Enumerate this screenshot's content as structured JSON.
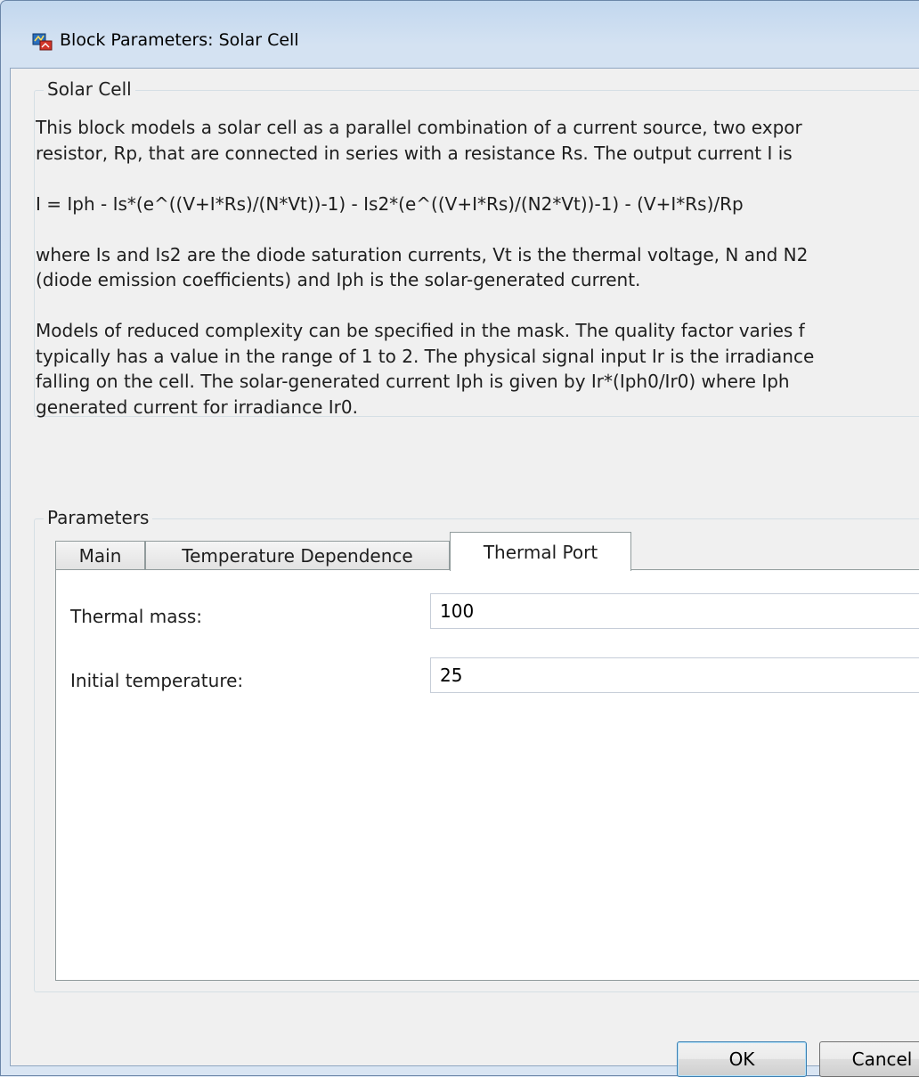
{
  "window": {
    "title": "Block Parameters: Solar Cell",
    "icon": "simulink-block-icon"
  },
  "description_group": {
    "legend": "Solar Cell",
    "lines": [
      "This block models a solar cell as a parallel combination of a current source, two expor",
      "resistor, Rp, that are connected in series with a resistance Rs. The output current I is",
      "",
      "I = Iph - Is*(e^((V+I*Rs)/(N*Vt))-1) - Is2*(e^((V+I*Rs)/(N2*Vt))-1) - (V+I*Rs)/Rp",
      "",
      "where Is and Is2 are the diode saturation currents, Vt is the thermal voltage, N and N2",
      "(diode emission coefficients) and Iph is the solar-generated current.",
      "",
      "Models of reduced complexity can be specified in the mask. The quality factor varies f",
      "typically has a value in the range of 1 to 2. The physical signal input Ir is the irradiance",
      "falling on the cell. The solar-generated current Iph is given by Ir*(Iph0/Ir0) where Iph",
      "generated current for irradiance Ir0."
    ]
  },
  "parameters_group": {
    "legend": "Parameters",
    "tabs": [
      {
        "label": "Main",
        "active": false
      },
      {
        "label": "Temperature Dependence",
        "active": false
      },
      {
        "label": "Thermal Port",
        "active": true
      }
    ],
    "fields": [
      {
        "label": "Thermal mass:",
        "value": "100"
      },
      {
        "label": "Initial temperature:",
        "value": "25"
      }
    ]
  },
  "buttons": {
    "ok": "OK",
    "cancel": "Cancel"
  },
  "colors": {
    "title_bar": "#c2d7ee",
    "dialog_bg": "#f0f0f0",
    "default_button_border": "#3c7fb1"
  }
}
